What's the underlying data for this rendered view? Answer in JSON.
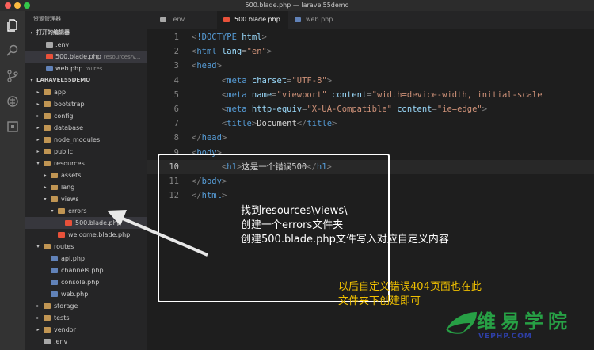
{
  "window": {
    "title": "500.blade.php — laravel55demo"
  },
  "sidebar": {
    "header": "资源管理器",
    "open_editors_title": "打开的编辑器",
    "open_editors": [
      {
        "name": ".env",
        "hint": "",
        "icon": "gear"
      },
      {
        "name": "500.blade.php",
        "hint": "resources/v...",
        "icon": "laravel"
      },
      {
        "name": "web.php",
        "hint": "routes",
        "icon": "php"
      }
    ],
    "project_title": "LARAVEL55DEMO",
    "tree": [
      {
        "name": "app",
        "type": "folder",
        "expanded": false,
        "depth": 0
      },
      {
        "name": "bootstrap",
        "type": "folder",
        "expanded": false,
        "depth": 0
      },
      {
        "name": "config",
        "type": "folder",
        "expanded": false,
        "depth": 0
      },
      {
        "name": "database",
        "type": "folder",
        "expanded": false,
        "depth": 0
      },
      {
        "name": "node_modules",
        "type": "folder",
        "expanded": false,
        "depth": 0
      },
      {
        "name": "public",
        "type": "folder",
        "expanded": false,
        "depth": 0
      },
      {
        "name": "resources",
        "type": "folder",
        "expanded": true,
        "depth": 0
      },
      {
        "name": "assets",
        "type": "folder",
        "expanded": false,
        "depth": 1
      },
      {
        "name": "lang",
        "type": "folder",
        "expanded": false,
        "depth": 1
      },
      {
        "name": "views",
        "type": "folder",
        "expanded": true,
        "depth": 1
      },
      {
        "name": "errors",
        "type": "folder",
        "expanded": true,
        "depth": 2
      },
      {
        "name": "500.blade.php",
        "type": "laravel",
        "depth": 3,
        "selected": true
      },
      {
        "name": "welcome.blade.php",
        "type": "laravel",
        "depth": 2
      },
      {
        "name": "routes",
        "type": "folder",
        "expanded": true,
        "depth": 0
      },
      {
        "name": "api.php",
        "type": "php",
        "depth": 1
      },
      {
        "name": "channels.php",
        "type": "php",
        "depth": 1
      },
      {
        "name": "console.php",
        "type": "php",
        "depth": 1
      },
      {
        "name": "web.php",
        "type": "php",
        "depth": 1
      },
      {
        "name": "storage",
        "type": "folder",
        "expanded": false,
        "depth": 0
      },
      {
        "name": "tests",
        "type": "folder",
        "expanded": false,
        "depth": 0
      },
      {
        "name": "vendor",
        "type": "folder",
        "expanded": false,
        "depth": 0
      },
      {
        "name": ".env",
        "type": "gear",
        "depth": 0
      }
    ]
  },
  "tabs": [
    {
      "label": ".env",
      "active": false,
      "icon": "gear"
    },
    {
      "label": "500.blade.php",
      "active": true,
      "icon": "laravel"
    },
    {
      "label": "web.php",
      "active": false,
      "icon": "php"
    }
  ],
  "editor": {
    "current_line": 10,
    "lines": [
      {
        "n": "1",
        "code": [
          [
            "p",
            "<"
          ],
          [
            "t",
            "!DOCTYPE"
          ],
          [
            "a",
            " html"
          ],
          [
            "p",
            ">"
          ]
        ]
      },
      {
        "n": "2",
        "code": [
          [
            "p",
            "<"
          ],
          [
            "t",
            "html"
          ],
          [
            "a",
            " lang"
          ],
          [
            "p",
            "="
          ],
          [
            "s",
            "\"en\""
          ],
          [
            "p",
            ">"
          ]
        ]
      },
      {
        "n": "3",
        "code": [
          [
            "p",
            "<"
          ],
          [
            "t",
            "head"
          ],
          [
            "p",
            ">"
          ]
        ]
      },
      {
        "n": "4",
        "code": [
          [
            "p",
            "      <"
          ],
          [
            "t",
            "meta"
          ],
          [
            "a",
            " charset"
          ],
          [
            "p",
            "="
          ],
          [
            "s",
            "\"UTF-8\""
          ],
          [
            "p",
            ">"
          ]
        ]
      },
      {
        "n": "5",
        "code": [
          [
            "p",
            "      <"
          ],
          [
            "t",
            "meta"
          ],
          [
            "a",
            " name"
          ],
          [
            "p",
            "="
          ],
          [
            "s",
            "\"viewport\""
          ],
          [
            "a",
            " content"
          ],
          [
            "p",
            "="
          ],
          [
            "s",
            "\"width=device-width, initial-scale"
          ]
        ]
      },
      {
        "n": "6",
        "code": [
          [
            "p",
            "      <"
          ],
          [
            "t",
            "meta"
          ],
          [
            "a",
            " http-equiv"
          ],
          [
            "p",
            "="
          ],
          [
            "s",
            "\"X-UA-Compatible\""
          ],
          [
            "a",
            " content"
          ],
          [
            "p",
            "="
          ],
          [
            "s",
            "\"ie=edge\""
          ],
          [
            "p",
            ">"
          ]
        ]
      },
      {
        "n": "7",
        "code": [
          [
            "p",
            "      <"
          ],
          [
            "t",
            "title"
          ],
          [
            "p",
            ">"
          ],
          [
            "c",
            "Document"
          ],
          [
            "p",
            "</"
          ],
          [
            "t",
            "title"
          ],
          [
            "p",
            ">"
          ]
        ]
      },
      {
        "n": "8",
        "code": [
          [
            "p",
            "</"
          ],
          [
            "t",
            "head"
          ],
          [
            "p",
            ">"
          ]
        ]
      },
      {
        "n": "9",
        "code": [
          [
            "p",
            "<"
          ],
          [
            "t",
            "body"
          ],
          [
            "p",
            ">"
          ]
        ]
      },
      {
        "n": "10",
        "code": [
          [
            "p",
            "      <"
          ],
          [
            "t",
            "h1"
          ],
          [
            "p",
            ">"
          ],
          [
            "c",
            "这是一个错误500"
          ],
          [
            "p",
            "</"
          ],
          [
            "t",
            "h1"
          ],
          [
            "p",
            ">"
          ]
        ]
      },
      {
        "n": "11",
        "code": [
          [
            "p",
            "</"
          ],
          [
            "t",
            "body"
          ],
          [
            "p",
            ">"
          ]
        ]
      },
      {
        "n": "12",
        "code": [
          [
            "p",
            "</"
          ],
          [
            "t",
            "html"
          ],
          [
            "p",
            ">"
          ]
        ]
      }
    ]
  },
  "annotation": {
    "lines": [
      "找到resources\\views\\",
      "创建一个errors文件夹",
      "创建500.blade.php文件写入对应自定义内容"
    ],
    "note": [
      "以后自定义错误404页面也在此",
      "文件夹下创建即可"
    ]
  },
  "watermark": {
    "text": "维易学院",
    "url": "VEPHP.COM"
  },
  "colors": {
    "tag": "#569cd6",
    "attr": "#9cdcfe",
    "string": "#ce9178",
    "punct": "#808080",
    "text": "#d4d4d4",
    "note": "#f0c000",
    "watermark": "#27a045"
  }
}
